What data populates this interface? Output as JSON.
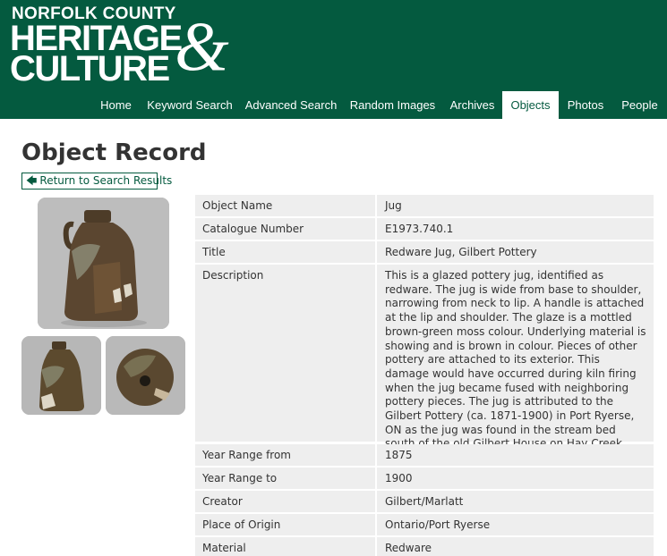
{
  "header": {
    "logo_top": "NORFOLK COUNTY",
    "logo_line1": "HERITAGE",
    "logo_line2": "CULTURE",
    "logo_amp": "&"
  },
  "nav": {
    "items": [
      {
        "label": "Home",
        "active": false
      },
      {
        "label": "Keyword Search",
        "active": false
      },
      {
        "label": "Advanced Search",
        "active": false
      },
      {
        "label": "Random Images",
        "active": false
      },
      {
        "label": "Archives",
        "active": false
      },
      {
        "label": "Objects",
        "active": true
      },
      {
        "label": "Photos",
        "active": false
      },
      {
        "label": "People",
        "active": false
      }
    ]
  },
  "page": {
    "title": "Object Record",
    "return_label": "Return to Search Results"
  },
  "record": {
    "rows": [
      {
        "label": "Object Name",
        "value": "Jug"
      },
      {
        "label": "Catalogue Number",
        "value": "E1973.740.1"
      },
      {
        "label": "Title",
        "value": "Redware Jug, Gilbert Pottery"
      },
      {
        "label": "Description",
        "value": "This is a glazed pottery jug, identified as redware. The jug is wide from base to shoulder, narrowing from neck to lip. A handle is attached at the lip and shoulder. The glaze is a mottled brown-green moss colour. Underlying material is showing and is brown in colour. Pieces of other pottery are attached to its exterior. This damage would have occurred during kiln firing when the jug became fused with neighboring pottery pieces. The jug is attributed to the Gilbert Pottery (ca. 1871-1900) in Port Ryerse, ON as the jug was found in the stream bed south of the old Gilbert House on Hay Creek, Port Ryerse."
      },
      {
        "label": "Year Range from",
        "value": "1875"
      },
      {
        "label": "Year Range to",
        "value": "1900"
      },
      {
        "label": "Creator",
        "value": "Gilbert/Marlatt"
      },
      {
        "label": "Place of Origin",
        "value": "Ontario/Port Ryerse"
      },
      {
        "label": "Material",
        "value": "Redware"
      }
    ]
  },
  "colors": {
    "brand_green": "#045a3f",
    "row_bg": "#eeeeee"
  }
}
